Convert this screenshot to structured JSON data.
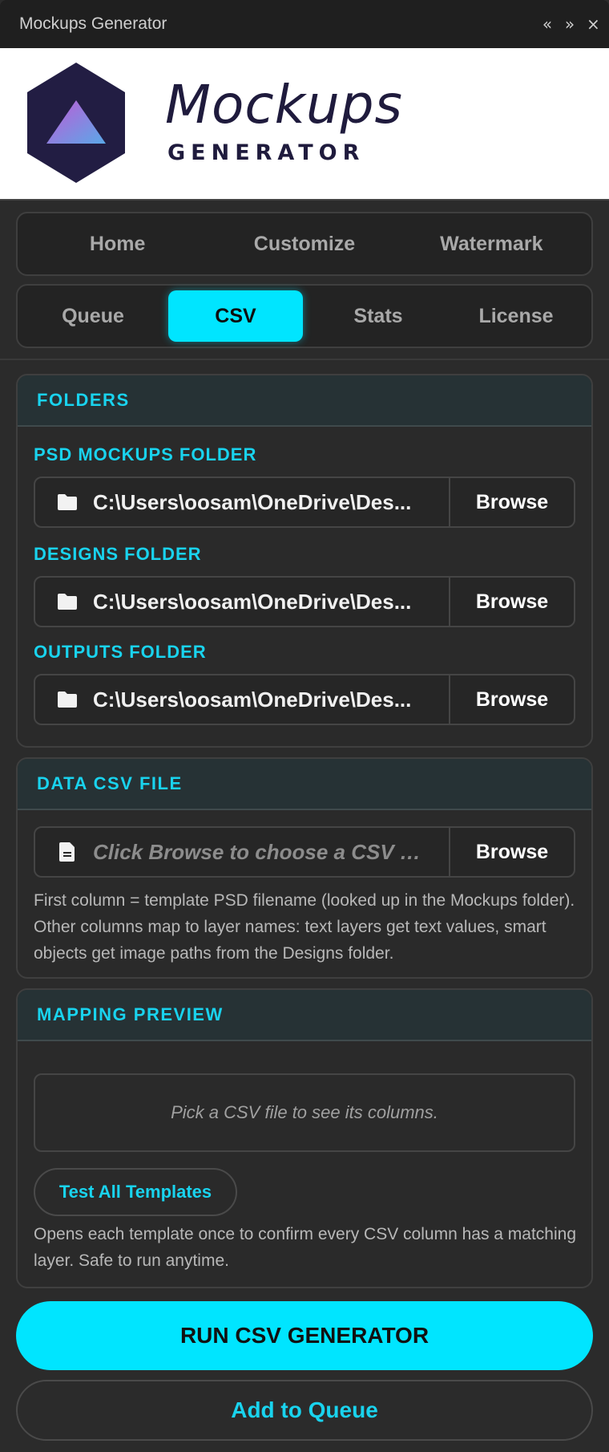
{
  "window": {
    "title": "Mockups Generator",
    "controls": [
      "«",
      "»",
      "×"
    ]
  },
  "logo": {
    "main": "Mockups",
    "sub": "GENERATOR"
  },
  "nav": {
    "row1": [
      "Home",
      "Customize",
      "Watermark"
    ],
    "row2": [
      "Queue",
      "CSV",
      "Stats",
      "License"
    ],
    "active": "CSV"
  },
  "folders": {
    "heading": "FOLDERS",
    "psd": {
      "label": "PSD MOCKUPS FOLDER",
      "path": "C:\\Users\\oosam\\OneDrive\\Des...",
      "browse": "Browse",
      "icon": "folder-icon"
    },
    "designs": {
      "label": "DESIGNS FOLDER",
      "path": "C:\\Users\\oosam\\OneDrive\\Des...",
      "browse": "Browse",
      "icon": "folder-icon"
    },
    "outputs": {
      "label": "OUTPUTS FOLDER",
      "path": "C:\\Users\\oosam\\OneDrive\\Des...",
      "browse": "Browse",
      "icon": "folder-icon"
    }
  },
  "csv": {
    "heading": "DATA CSV FILE",
    "placeholder": "Click Browse to choose a CSV file",
    "browse": "Browse",
    "icon": "file-icon",
    "help": "First column = template PSD filename (looked up in the Mockups folder). Other columns map to layer names: text layers get text values, smart objects get image paths from the Designs folder."
  },
  "mapping": {
    "heading": "MAPPING PREVIEW",
    "empty": "Pick a CSV file to see its columns.",
    "test_button": "Test All Templates",
    "help": "Opens each template once to confirm every CSV column has a matching layer. Safe to run anytime."
  },
  "actions": {
    "run": "RUN CSV GENERATOR",
    "queue": "Add to Queue"
  },
  "colors": {
    "accent": "#00e5ff",
    "background": "#2b2b2b",
    "logo_dark": "#1f1b3d"
  }
}
